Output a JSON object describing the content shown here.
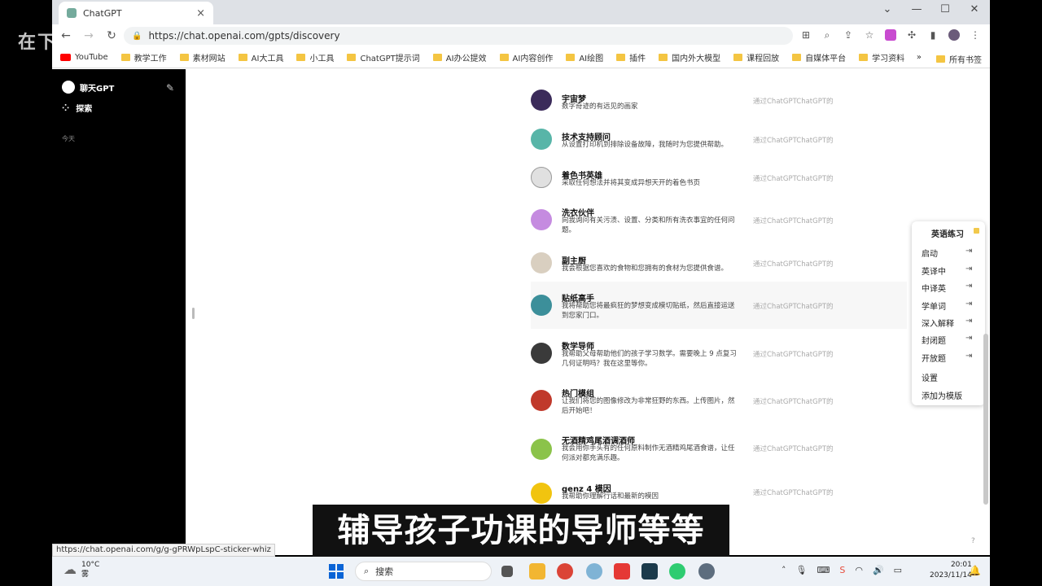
{
  "overlay": {
    "text": "在下"
  },
  "browser": {
    "tab_title": "ChatGPT",
    "tab_close": "×",
    "url": "https://chat.openai.com/gpts/discovery",
    "window_controls": {
      "minimize": "⌄",
      "restore": "—",
      "maximize": "☐",
      "close": "✕"
    },
    "nav": {
      "back": "←",
      "forward": "→",
      "reload": "↻"
    }
  },
  "bookmarks": {
    "items": [
      "YouTube",
      "教学工作",
      "素材网站",
      "AI大工具",
      "小工具",
      "ChatGPT提示词",
      "AI办公提效",
      "AI内容创作",
      "AI绘图",
      "插件",
      "国内外大模型",
      "课程回放",
      "自媒体平台",
      "学习资料"
    ],
    "overflow": "»",
    "all_bookmarks": "所有书签"
  },
  "sidebar": {
    "chat_label": "聊天GPT",
    "explore_label": "探索",
    "today_label": "今天"
  },
  "gpts": [
    {
      "name": "宇宙梦",
      "desc": "数字奇迹的有远见的画家",
      "by": "通过ChatGPTChatGPT的",
      "color": "#3b2b5a"
    },
    {
      "name": "技术支持顾问",
      "desc": "从设置打印机到排除设备故障，我随时为您提供帮助。",
      "by": "通过ChatGPTChatGPT的",
      "color": "#58b5a8"
    },
    {
      "name": "着色书英雄",
      "desc": "采取任何想法并将其变成异想天开的着色书页",
      "by": "通过ChatGPTChatGPT的",
      "color": "#e0e0e0"
    },
    {
      "name": "洗衣伙伴",
      "desc": "向我询问有关污渍、设置、分类和所有洗衣事宜的任何问题。",
      "by": "通过ChatGPTChatGPT的",
      "color": "#c58be0"
    },
    {
      "name": "副主厨",
      "desc": "我会根据您喜欢的食物和您拥有的食材为您提供食谱。",
      "by": "通过ChatGPTChatGPT的",
      "color": "#d9cfc0"
    },
    {
      "name": "贴纸高手",
      "desc": "我将帮助您将最疯狂的梦想变成模切贴纸，然后直接运送到您家门口。",
      "by": "通过ChatGPTChatGPT的",
      "color": "#3c8f9a"
    },
    {
      "name": "数学导师",
      "desc": "我帮助父母帮助他们的孩子学习数学。需要晚上 9 点复习几何证明吗？我在这里等你。",
      "by": "通过ChatGPTChatGPT的",
      "color": "#3a3a3a"
    },
    {
      "name": "热门模组",
      "desc": "让我们将您的图像修改为非常狂野的东西。上传图片，然后开始吧！",
      "by": "通过ChatGPTChatGPT的",
      "color": "#c0392b"
    },
    {
      "name": "无酒精鸡尾酒调酒师",
      "desc": "我会用你手头有的任何原料制作无酒精鸡尾酒食谱，让任何派对都充满乐趣。",
      "by": "通过ChatGPTChatGPT的",
      "color": "#8bc34a"
    },
    {
      "name": "genz 4 模因",
      "desc": "我帮助你理解行话和最新的模因",
      "by": "通过ChatGPTChatGPT的",
      "color": "#f1c40f"
    }
  ],
  "float_menu": {
    "title": "英语练习",
    "items": [
      "启动",
      "英译中",
      "中译英",
      "学单词",
      "深入解释",
      "封闭题",
      "开放题"
    ],
    "arrow": "⇥",
    "settings": "设置",
    "add_template": "添加为模版"
  },
  "status_url": "https://chat.openai.com/g/g-gPRWpLspC-sticker-whiz",
  "subtitle": "辅导孩子功课的导师等等",
  "taskbar": {
    "temperature": "10°C",
    "weather": "雾",
    "search_placeholder": "搜索",
    "time": "20:01",
    "date": "2023/11/14",
    "help": "?"
  }
}
